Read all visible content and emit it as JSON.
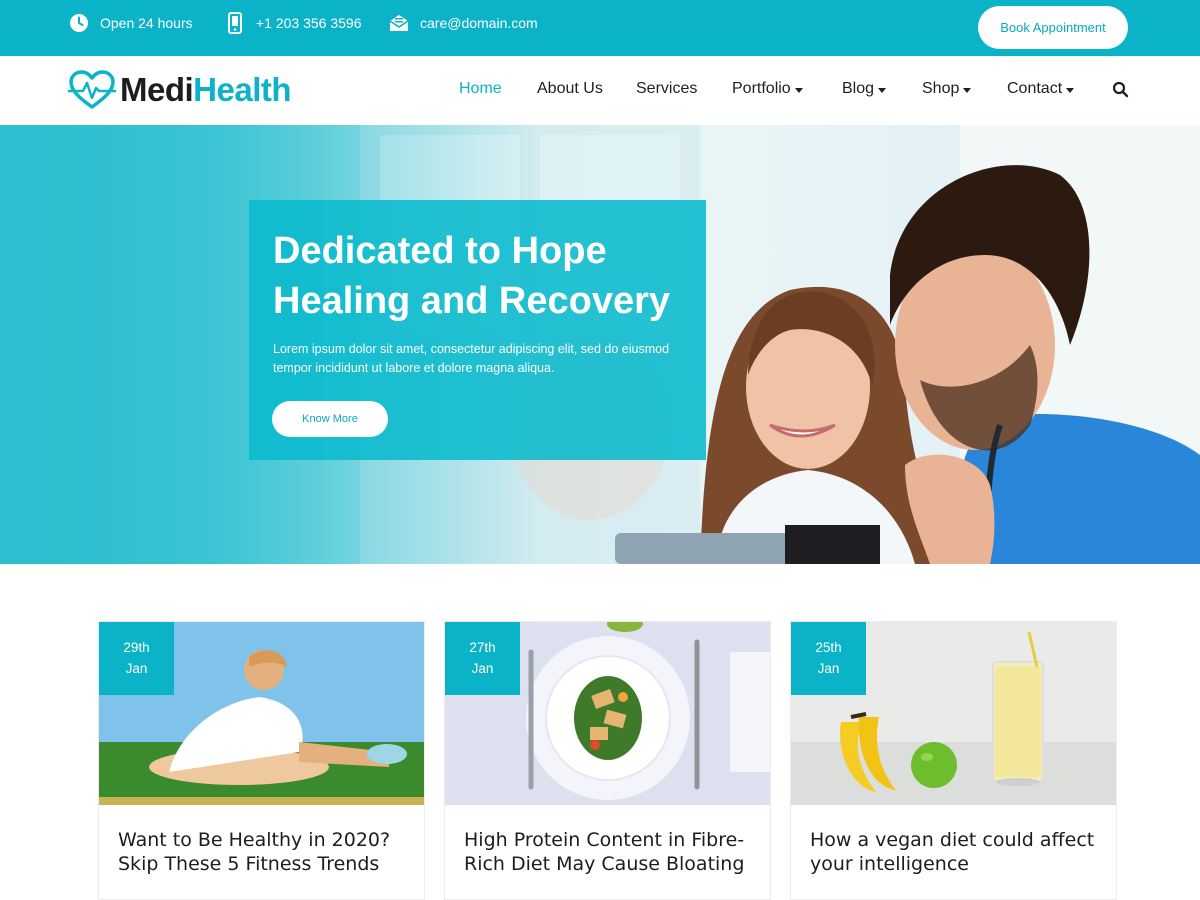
{
  "topbar": {
    "hours": "Open 24 hours",
    "phone": "+1 203 356 3596",
    "email": "care@domain.com",
    "book_button": "Book Appointment"
  },
  "logo": {
    "part1": "Medi",
    "part2": "Health"
  },
  "nav": {
    "items": [
      {
        "label": "Home",
        "active": true,
        "dropdown": false
      },
      {
        "label": "About Us",
        "dropdown": false
      },
      {
        "label": "Services",
        "dropdown": false
      },
      {
        "label": "Portfolio",
        "dropdown": true
      },
      {
        "label": "Blog",
        "dropdown": true
      },
      {
        "label": "Shop",
        "dropdown": true
      },
      {
        "label": "Contact",
        "dropdown": true
      }
    ],
    "search_icon": "search-icon"
  },
  "hero": {
    "title": "Dedicated to Hope Healing and Recovery",
    "text": "Lorem ipsum dolor sit amet, consectetur adipiscing elit, sed do eiusmod tempor incididunt ut labore et dolore magna aliqua.",
    "button": "Know More"
  },
  "posts": [
    {
      "day": "29th",
      "month": "Jan",
      "title": "Want to Be Healthy in 2020? Skip These 5 Fitness Trends"
    },
    {
      "day": "27th",
      "month": "Jan",
      "title": "High Protein Content in Fibre-Rich Diet May Cause Bloating"
    },
    {
      "day": "25th",
      "month": "Jan",
      "title": "How a vegan diet could affect your intelligence"
    }
  ],
  "colors": {
    "accent": "#0bb3c8",
    "text": "#1f1f1f"
  }
}
